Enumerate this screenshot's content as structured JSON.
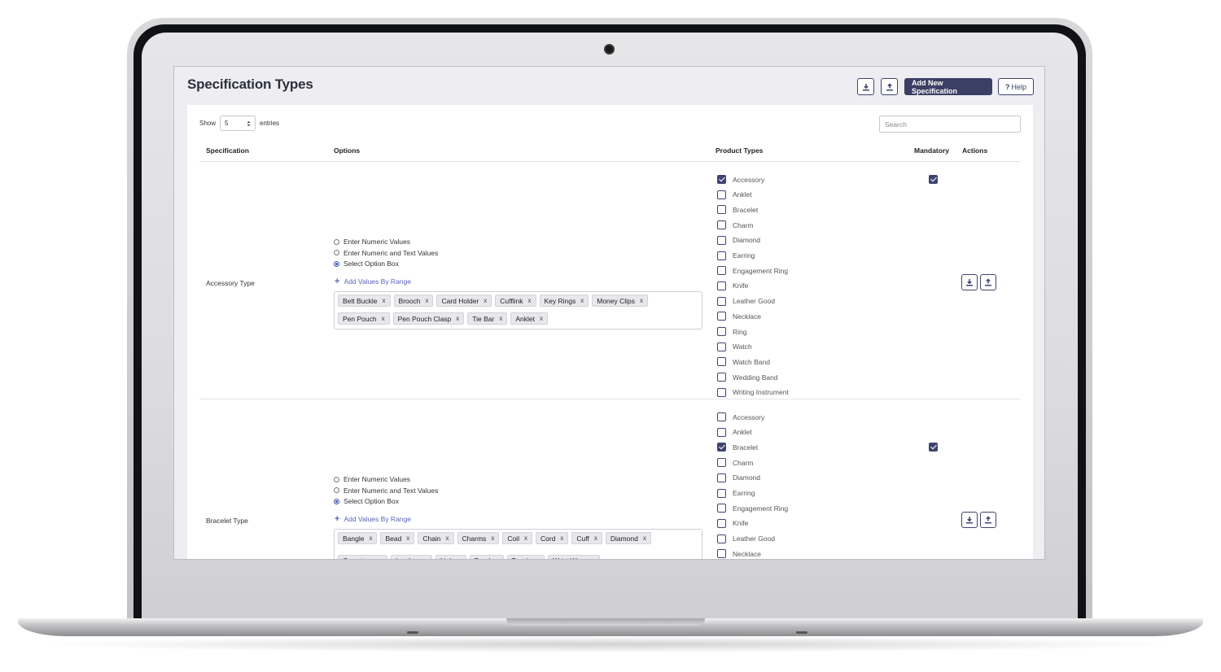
{
  "page": {
    "title": "Specification Types",
    "add_button": "Add New Specification",
    "help_button": "Help",
    "help_icon_glyph": "?"
  },
  "table_controls": {
    "show_label": "Show",
    "entries_value": "5",
    "entries_label": "entries",
    "search_placeholder": "Search"
  },
  "columns": {
    "specification": "Specification",
    "options": "Options",
    "product_types": "Product Types",
    "mandatory": "Mandatory",
    "actions": "Actions"
  },
  "option_modes": [
    "Enter Numeric Values",
    "Enter Numeric and Text Values",
    "Select Option Box"
  ],
  "add_values_label": "Add Values By Range",
  "tag_remove_glyph": "x",
  "rows": [
    {
      "name": "Accessory Type",
      "selected_mode": 2,
      "mandatory": true,
      "tags": [
        "Belt Buckle",
        "Brooch",
        "Card Holder",
        "Cufflink",
        "Key Rings",
        "Money Clips",
        "Pen Pouch",
        "Pen Pouch Clasp",
        "Tie Bar",
        "Anklet"
      ],
      "product_types": [
        {
          "label": "Accessory",
          "checked": true
        },
        {
          "label": "Anklet",
          "checked": false
        },
        {
          "label": "Bracelet",
          "checked": false
        },
        {
          "label": "Charm",
          "checked": false
        },
        {
          "label": "Diamond",
          "checked": false
        },
        {
          "label": "Earring",
          "checked": false
        },
        {
          "label": "Engagement Ring",
          "checked": false
        },
        {
          "label": "Knife",
          "checked": false
        },
        {
          "label": "Leather Good",
          "checked": false
        },
        {
          "label": "Necklace",
          "checked": false
        },
        {
          "label": "Ring",
          "checked": false
        },
        {
          "label": "Watch",
          "checked": false
        },
        {
          "label": "Watch Band",
          "checked": false
        },
        {
          "label": "Wedding Band",
          "checked": false
        },
        {
          "label": "Writing Instrument",
          "checked": false
        }
      ]
    },
    {
      "name": "Bracelet Type",
      "selected_mode": 2,
      "mandatory": true,
      "tags": [
        "Bangle",
        "Bead",
        "Chain",
        "Charms",
        "Coil",
        "Cord",
        "Cuff",
        "Diamond",
        "Gemstone",
        "Leather",
        "Link",
        "Pearl",
        "Tennis",
        "Wrist Wrap"
      ],
      "product_types": [
        {
          "label": "Accessory",
          "checked": false
        },
        {
          "label": "Anklet",
          "checked": false
        },
        {
          "label": "Bracelet",
          "checked": true
        },
        {
          "label": "Charm",
          "checked": false
        },
        {
          "label": "Diamond",
          "checked": false
        },
        {
          "label": "Earring",
          "checked": false
        },
        {
          "label": "Engagement Ring",
          "checked": false
        },
        {
          "label": "Knife",
          "checked": false
        },
        {
          "label": "Leather Good",
          "checked": false
        },
        {
          "label": "Necklace",
          "checked": false
        }
      ]
    }
  ],
  "colors": {
    "primary": "#3b3f63",
    "accent_link": "#5865b8",
    "screen_bg": "#eeeef2"
  },
  "icons": [
    "download-icon",
    "upload-icon",
    "checkbox-checked-icon",
    "checkbox-empty-icon",
    "plus-icon",
    "remove-tag-icon",
    "select-caret-icon",
    "webcam"
  ]
}
